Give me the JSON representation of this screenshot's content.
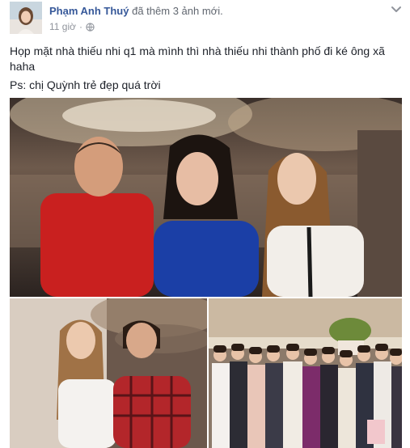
{
  "post": {
    "author": {
      "name": "Phạm Anh Thuý",
      "action": "đã thêm",
      "action_count": "3 ảnh mới."
    },
    "meta": {
      "time": "11 giờ",
      "separator": "·",
      "audience_icon": "globe-icon"
    },
    "menu_icon": "chevron-down-icon",
    "text_lines": [
      "Họp mặt nhà thiếu nhi q1 mà mình thì nhà thiếu nhi thành phố đi ké ông xã",
      "haha",
      "Ps: chị Quỳnh trẻ đẹp quá trời"
    ],
    "photos": [
      {
        "name": "group-photo-three-people"
      },
      {
        "name": "photo-two-women"
      },
      {
        "name": "photo-large-group"
      }
    ]
  },
  "colors": {
    "link": "#365899",
    "meta": "#90949c",
    "text": "#1d2129"
  }
}
